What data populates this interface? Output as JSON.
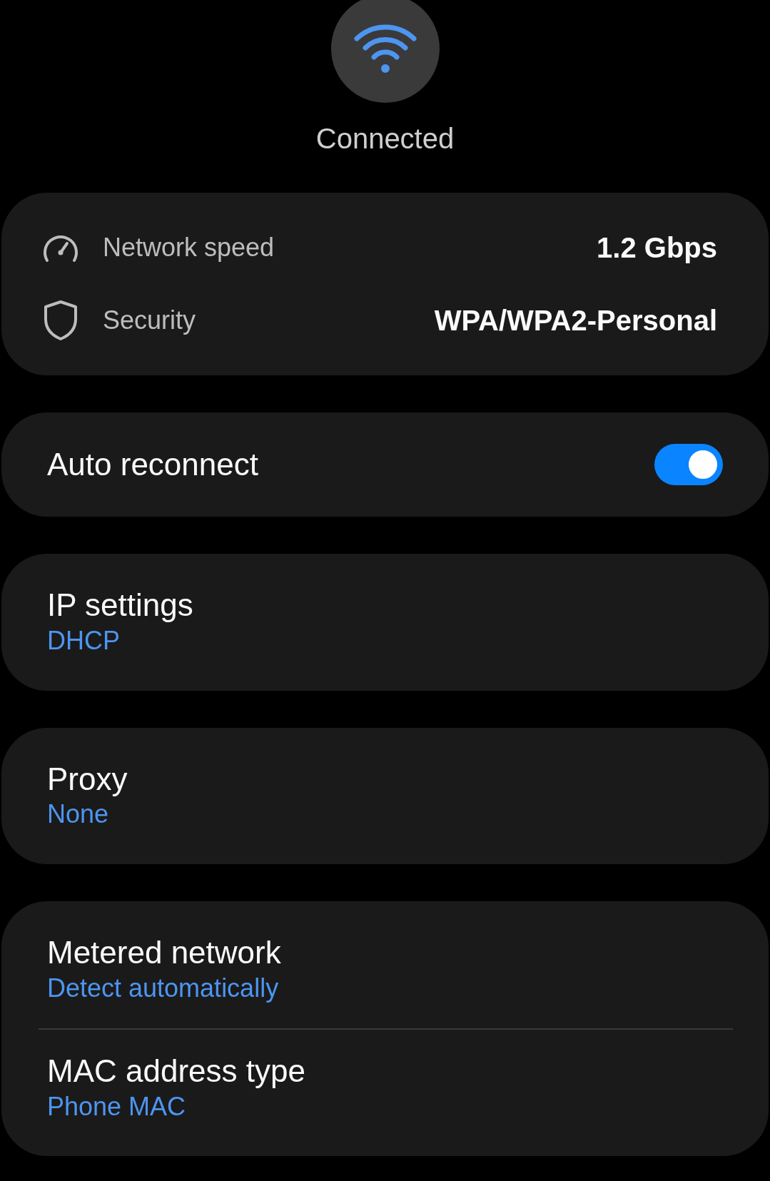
{
  "status": {
    "label": "Connected"
  },
  "info": [
    {
      "kind": "speed",
      "label": "Network speed",
      "value": "1.2 Gbps"
    },
    {
      "kind": "security",
      "label": "Security",
      "value": "WPA/WPA2-Personal"
    }
  ],
  "auto_reconnect": {
    "label": "Auto reconnect",
    "on": true
  },
  "groups": [
    [
      {
        "title": "IP settings",
        "value": "DHCP"
      }
    ],
    [
      {
        "title": "Proxy",
        "value": "None"
      }
    ],
    [
      {
        "title": "Metered network",
        "value": "Detect automatically"
      },
      {
        "title": "MAC address type",
        "value": "Phone MAC"
      }
    ]
  ]
}
